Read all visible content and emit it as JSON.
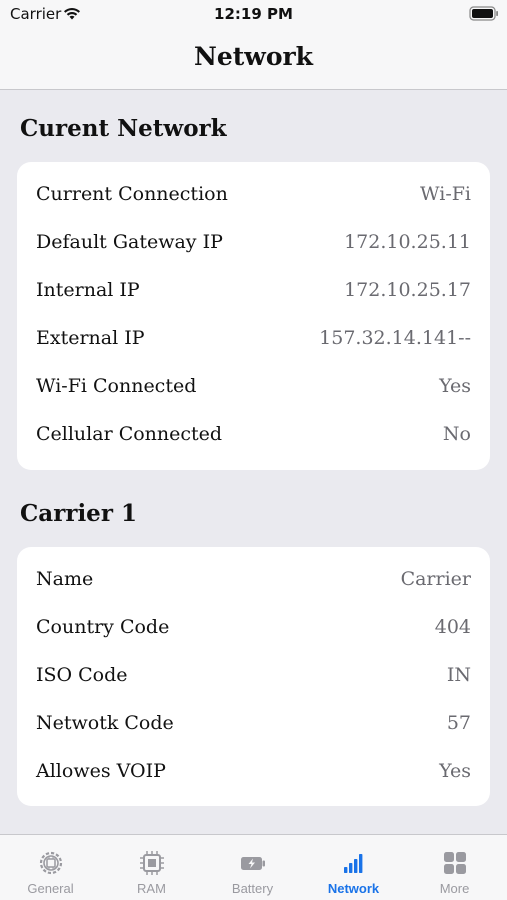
{
  "status_bar": {
    "carrier": "Carrier",
    "time": "12:19 PM"
  },
  "nav": {
    "title": "Network"
  },
  "current_network": {
    "title": "Curent Network",
    "rows": [
      {
        "label": "Current Connection",
        "value": "Wi-Fi"
      },
      {
        "label": "Default Gateway IP",
        "value": "172.10.25.11"
      },
      {
        "label": "Internal IP",
        "value": "172.10.25.17"
      },
      {
        "label": "External IP",
        "value": "157.32.14.141--"
      },
      {
        "label": "Wi-Fi Connected",
        "value": "Yes"
      },
      {
        "label": "Cellular Connected",
        "value": "No"
      }
    ]
  },
  "carrier": {
    "title": "Carrier 1",
    "rows": [
      {
        "label": "Name",
        "value": "Carrier"
      },
      {
        "label": "Country Code",
        "value": "404"
      },
      {
        "label": "ISO Code",
        "value": "IN"
      },
      {
        "label": "Netwotk Code",
        "value": "57"
      },
      {
        "label": "Allowes VOIP",
        "value": "Yes"
      }
    ]
  },
  "tabs": [
    {
      "label": "General",
      "icon": "cpu-gear-icon",
      "active": false
    },
    {
      "label": "RAM",
      "icon": "chip-icon",
      "active": false
    },
    {
      "label": "Battery",
      "icon": "battery-charging-icon",
      "active": false
    },
    {
      "label": "Network",
      "icon": "signal-bars-icon",
      "active": true
    },
    {
      "label": "More",
      "icon": "grid-icon",
      "active": false
    }
  ],
  "colors": {
    "accent": "#1a73e8",
    "inactive": "#9a9aa0",
    "background": "#eaeaef"
  }
}
